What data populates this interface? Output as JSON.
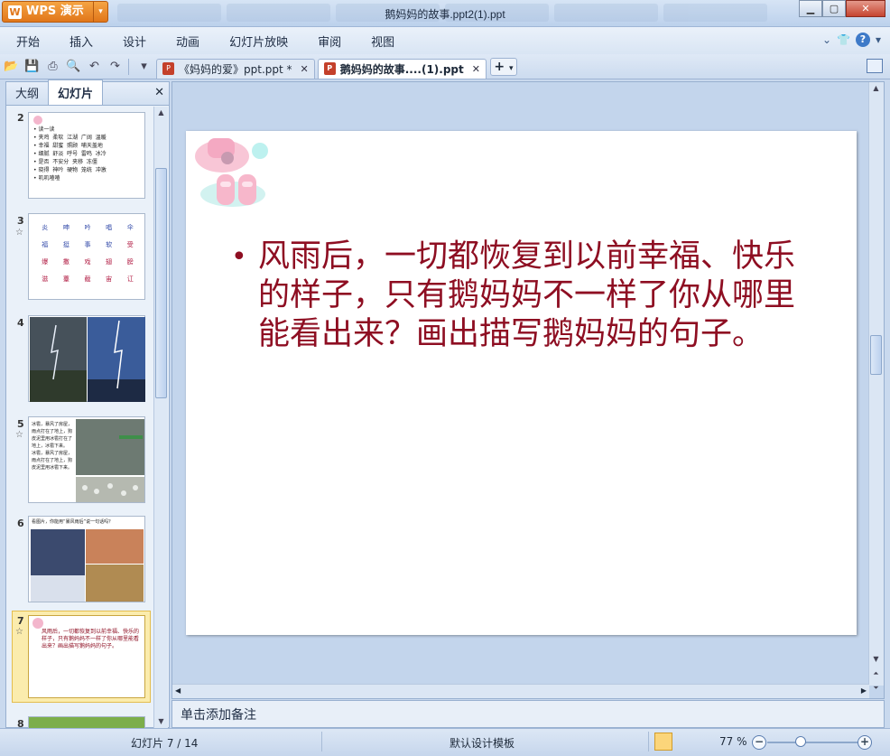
{
  "app": {
    "brand_label": "WPS 演示",
    "window_title": "鹅妈妈的故事.ppt2(1).ppt"
  },
  "window_controls": [
    "minimize-icon",
    "maximize-icon",
    "close-icon"
  ],
  "menu": {
    "items": [
      "开始",
      "插入",
      "设计",
      "动画",
      "幻灯片放映",
      "审阅",
      "视图"
    ]
  },
  "doc_tabs": [
    {
      "label": "《妈妈的爱》ppt.ppt *",
      "active": false
    },
    {
      "label": "鹅妈妈的故事....(1).ppt",
      "active": true
    }
  ],
  "left_pane": {
    "tabs": [
      "大纲",
      "幻灯片"
    ],
    "active_tab": "幻灯片",
    "slides": [
      {
        "num": "2",
        "starred": false,
        "text": "• 读一读\n• 夹鸡  柔软  江湖  广阔  温暖\n• 幸福  甜蜜  照顾  哺天盖地\n• 细腻  舒淡  呼号  雷鸣  冰冷\n• 是否  不安分  夹移  冻僵\n• 晓得  神吟  硬物  笼统  冲激\n• 叽叽喳喳"
      },
      {
        "num": "3",
        "starred": true,
        "grid": [
          [
            "炎",
            "呻",
            "吟",
            "唱",
            "伞"
          ],
          [
            "福",
            "挺",
            "事",
            "软",
            "受"
          ],
          [
            "爆",
            "撒",
            "戏",
            "翅",
            "膀"
          ],
          [
            "滋",
            "薹",
            "截",
            "宙",
            "讧"
          ]
        ]
      },
      {
        "num": "4",
        "starred": false
      },
      {
        "num": "5",
        "starred": true,
        "text": "冰雹，暴风了房屋，雨点打在了地上，狗皮泥里用冰雹打在了地上，冰雹下来。\n冰雹，暴风了房屋，雨点打在了地上，狗皮泥里用冰雹下来。"
      },
      {
        "num": "6",
        "starred": false,
        "text": "看图片，你能用“暴风雨后”说一句话吗？"
      },
      {
        "num": "7",
        "starred": true,
        "selected": true,
        "text": "风雨后，一切都恢复到以前幸福、快乐的样子，只有鹅妈妈不一样了你从哪里能看出来？画出描写鹅妈妈的句子。"
      },
      {
        "num": "8",
        "starred": false
      }
    ]
  },
  "slide": {
    "bullet": "•",
    "body": "风雨后，一切都恢复到以前幸福、快乐的样子，只有鹅妈妈不一样了你从哪里能看出来？画出描写鹅妈妈的句子。"
  },
  "notes": {
    "placeholder": "单击添加备注"
  },
  "status": {
    "slide_counter": "幻灯片 7 / 14",
    "template": "默认设计模板",
    "zoom": "77 %",
    "zoom_percent": 77
  },
  "colors": {
    "slide_text": "#8e0e22",
    "wps_orange": "#e1761a",
    "selected_thumb": "#fbecad"
  }
}
